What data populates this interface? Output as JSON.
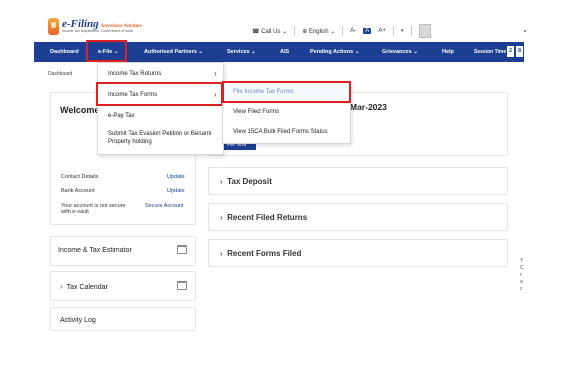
{
  "header": {
    "logo_title": "e-Filing",
    "logo_tagline": "Anywhere Anytime",
    "logo_sub": "Income Tax Department, Government of India",
    "call_us": "Call Us",
    "language": "English",
    "font_minus": "A-",
    "font_normal": "A",
    "font_plus": "A+"
  },
  "nav": {
    "dashboard": "Dashboard",
    "efile": "e-File",
    "authorised_partners": "Authorised Partners",
    "services": "Services",
    "ais": "AIS",
    "pending_actions": "Pending Actions",
    "grievances": "Grievances",
    "help": "Help",
    "session_label": "Session Time",
    "session_digit_1": "2",
    "session_digit_2": "8"
  },
  "breadcrumb": "Dashboard",
  "welcome": {
    "title": "Welcome",
    "contact_details_label": "Contact Details",
    "contact_details_link": "Update",
    "bank_account_label": "Bank Account",
    "bank_account_link": "Update",
    "secure_label": "Your account is not secure with e-vault",
    "secure_link": "Secure Account"
  },
  "side_cards": {
    "estimator": "Income & Tax Estimator",
    "calendar": "Tax Calendar",
    "activity_log": "Activity Log"
  },
  "main": {
    "date_title": "Mar-2023",
    "file_now_button": "File Now",
    "tax_deposit": "Tax Deposit",
    "recent_filed_returns": "Recent Filed Returns",
    "recent_forms_filed": "Recent Forms Filed"
  },
  "efile_menu": {
    "items": [
      "Income Tax Returns",
      "Income Tax Forms",
      "e-Pay Tax",
      "Submit Tax Evasion Petition or Benami Property holding"
    ]
  },
  "forms_submenu": {
    "items": [
      "File Income Tax Forms",
      "View Filed Forms",
      "View 15CA Bulk Filed Forms Status"
    ]
  },
  "colors": {
    "nav_blue": "#1c3f94",
    "highlight_red": "#e02020"
  }
}
